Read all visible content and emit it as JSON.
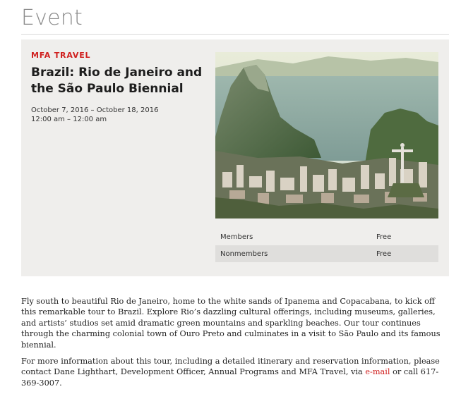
{
  "header": {
    "title": "Event"
  },
  "event": {
    "category": "MFA TRAVEL",
    "title": "Brazil: Rio de Janeiro and the São Paulo Biennial",
    "dates": "October 7, 2016 – October 18, 2016",
    "time": "12:00 am – 12:00 am",
    "image_subject": "rio-de-janeiro-landscape"
  },
  "pricing": [
    {
      "label": "Members",
      "value": "Free"
    },
    {
      "label": "Nonmembers",
      "value": "Free"
    }
  ],
  "description": {
    "paragraph1": "Fly south to beautiful Rio de Janeiro, home to the white sands of Ipanema and Copacabana, to kick off this remarkable tour to Brazil. Explore Rio’s dazzling cultural offerings, including museums, galleries, and artists’ studios set amid dramatic green mountains and sparkling beaches. Our tour continues through the charming colonial town of Ouro Preto and culminates in a visit to São Paulo and its famous biennial.",
    "paragraph2_before": "For more information about this tour, including a detailed itinerary and reservation information, please contact Dane Lighthart, Development Officer, Annual Programs and MFA Travel, via ",
    "email_link": "e-mail",
    "paragraph2_after": " or call 617-369-3007."
  },
  "colors": {
    "accent": "#d0201f",
    "panel_bg": "#efeeec",
    "row_alt_bg": "#dfdedc",
    "header_text": "#8c8c8c"
  }
}
